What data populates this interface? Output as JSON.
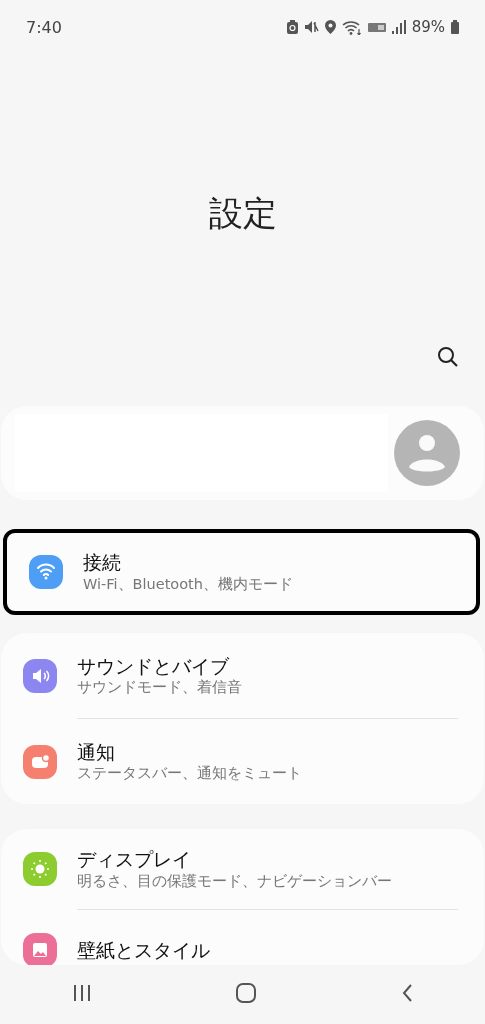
{
  "status_bar": {
    "time": "7:40",
    "battery": "89%"
  },
  "title": "設定",
  "groups": [
    {
      "highlighted": true,
      "items": [
        {
          "kind": "wifi",
          "color": "#4f9ef5",
          "title": "接続",
          "subtitle": "Wi-Fi、Bluetooth、機内モード"
        }
      ]
    },
    {
      "highlighted": false,
      "items": [
        {
          "kind": "sound",
          "color": "#8c86f0",
          "title": "サウンドとバイブ",
          "subtitle": "サウンドモード、着信音"
        },
        {
          "kind": "notification",
          "color": "#f5806f",
          "title": "通知",
          "subtitle": "ステータスバー、通知をミュート"
        }
      ]
    },
    {
      "highlighted": false,
      "items": [
        {
          "kind": "display",
          "color": "#8ccc2e",
          "title": "ディスプレイ",
          "subtitle": "明るさ、目の保護モード、ナビゲーションバー"
        },
        {
          "kind": "wallpaper",
          "color": "#ec6f98",
          "title": "壁紙とスタイル"
        }
      ]
    }
  ]
}
